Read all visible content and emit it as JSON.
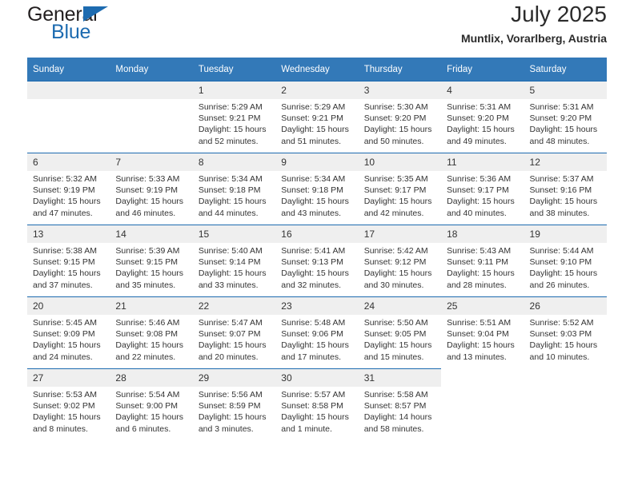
{
  "brand": {
    "name_top": "General",
    "name_bottom": "Blue",
    "accent_color": "#1d6bb0",
    "triangle_icon": "triangle-right-icon"
  },
  "header": {
    "title": "July 2025",
    "subtitle": "Muntlix, Vorarlberg, Austria"
  },
  "calendar": {
    "header_bg": "#3379b8",
    "divider_color": "#1d6bb0",
    "daynum_bg": "#efefef",
    "weekdays": [
      "Sunday",
      "Monday",
      "Tuesday",
      "Wednesday",
      "Thursday",
      "Friday",
      "Saturday"
    ],
    "weeks": [
      [
        {
          "day": "",
          "blank": true,
          "lines": []
        },
        {
          "day": "",
          "blank": true,
          "lines": []
        },
        {
          "day": "1",
          "lines": [
            "Sunrise: 5:29 AM",
            "Sunset: 9:21 PM",
            "Daylight: 15 hours",
            "and 52 minutes."
          ]
        },
        {
          "day": "2",
          "lines": [
            "Sunrise: 5:29 AM",
            "Sunset: 9:21 PM",
            "Daylight: 15 hours",
            "and 51 minutes."
          ]
        },
        {
          "day": "3",
          "lines": [
            "Sunrise: 5:30 AM",
            "Sunset: 9:20 PM",
            "Daylight: 15 hours",
            "and 50 minutes."
          ]
        },
        {
          "day": "4",
          "lines": [
            "Sunrise: 5:31 AM",
            "Sunset: 9:20 PM",
            "Daylight: 15 hours",
            "and 49 minutes."
          ]
        },
        {
          "day": "5",
          "lines": [
            "Sunrise: 5:31 AM",
            "Sunset: 9:20 PM",
            "Daylight: 15 hours",
            "and 48 minutes."
          ]
        }
      ],
      [
        {
          "day": "6",
          "lines": [
            "Sunrise: 5:32 AM",
            "Sunset: 9:19 PM",
            "Daylight: 15 hours",
            "and 47 minutes."
          ]
        },
        {
          "day": "7",
          "lines": [
            "Sunrise: 5:33 AM",
            "Sunset: 9:19 PM",
            "Daylight: 15 hours",
            "and 46 minutes."
          ]
        },
        {
          "day": "8",
          "lines": [
            "Sunrise: 5:34 AM",
            "Sunset: 9:18 PM",
            "Daylight: 15 hours",
            "and 44 minutes."
          ]
        },
        {
          "day": "9",
          "lines": [
            "Sunrise: 5:34 AM",
            "Sunset: 9:18 PM",
            "Daylight: 15 hours",
            "and 43 minutes."
          ]
        },
        {
          "day": "10",
          "lines": [
            "Sunrise: 5:35 AM",
            "Sunset: 9:17 PM",
            "Daylight: 15 hours",
            "and 42 minutes."
          ]
        },
        {
          "day": "11",
          "lines": [
            "Sunrise: 5:36 AM",
            "Sunset: 9:17 PM",
            "Daylight: 15 hours",
            "and 40 minutes."
          ]
        },
        {
          "day": "12",
          "lines": [
            "Sunrise: 5:37 AM",
            "Sunset: 9:16 PM",
            "Daylight: 15 hours",
            "and 38 minutes."
          ]
        }
      ],
      [
        {
          "day": "13",
          "lines": [
            "Sunrise: 5:38 AM",
            "Sunset: 9:15 PM",
            "Daylight: 15 hours",
            "and 37 minutes."
          ]
        },
        {
          "day": "14",
          "lines": [
            "Sunrise: 5:39 AM",
            "Sunset: 9:15 PM",
            "Daylight: 15 hours",
            "and 35 minutes."
          ]
        },
        {
          "day": "15",
          "lines": [
            "Sunrise: 5:40 AM",
            "Sunset: 9:14 PM",
            "Daylight: 15 hours",
            "and 33 minutes."
          ]
        },
        {
          "day": "16",
          "lines": [
            "Sunrise: 5:41 AM",
            "Sunset: 9:13 PM",
            "Daylight: 15 hours",
            "and 32 minutes."
          ]
        },
        {
          "day": "17",
          "lines": [
            "Sunrise: 5:42 AM",
            "Sunset: 9:12 PM",
            "Daylight: 15 hours",
            "and 30 minutes."
          ]
        },
        {
          "day": "18",
          "lines": [
            "Sunrise: 5:43 AM",
            "Sunset: 9:11 PM",
            "Daylight: 15 hours",
            "and 28 minutes."
          ]
        },
        {
          "day": "19",
          "lines": [
            "Sunrise: 5:44 AM",
            "Sunset: 9:10 PM",
            "Daylight: 15 hours",
            "and 26 minutes."
          ]
        }
      ],
      [
        {
          "day": "20",
          "lines": [
            "Sunrise: 5:45 AM",
            "Sunset: 9:09 PM",
            "Daylight: 15 hours",
            "and 24 minutes."
          ]
        },
        {
          "day": "21",
          "lines": [
            "Sunrise: 5:46 AM",
            "Sunset: 9:08 PM",
            "Daylight: 15 hours",
            "and 22 minutes."
          ]
        },
        {
          "day": "22",
          "lines": [
            "Sunrise: 5:47 AM",
            "Sunset: 9:07 PM",
            "Daylight: 15 hours",
            "and 20 minutes."
          ]
        },
        {
          "day": "23",
          "lines": [
            "Sunrise: 5:48 AM",
            "Sunset: 9:06 PM",
            "Daylight: 15 hours",
            "and 17 minutes."
          ]
        },
        {
          "day": "24",
          "lines": [
            "Sunrise: 5:50 AM",
            "Sunset: 9:05 PM",
            "Daylight: 15 hours",
            "and 15 minutes."
          ]
        },
        {
          "day": "25",
          "lines": [
            "Sunrise: 5:51 AM",
            "Sunset: 9:04 PM",
            "Daylight: 15 hours",
            "and 13 minutes."
          ]
        },
        {
          "day": "26",
          "lines": [
            "Sunrise: 5:52 AM",
            "Sunset: 9:03 PM",
            "Daylight: 15 hours",
            "and 10 minutes."
          ]
        }
      ],
      [
        {
          "day": "27",
          "lines": [
            "Sunrise: 5:53 AM",
            "Sunset: 9:02 PM",
            "Daylight: 15 hours",
            "and 8 minutes."
          ]
        },
        {
          "day": "28",
          "lines": [
            "Sunrise: 5:54 AM",
            "Sunset: 9:00 PM",
            "Daylight: 15 hours",
            "and 6 minutes."
          ]
        },
        {
          "day": "29",
          "lines": [
            "Sunrise: 5:56 AM",
            "Sunset: 8:59 PM",
            "Daylight: 15 hours",
            "and 3 minutes."
          ]
        },
        {
          "day": "30",
          "lines": [
            "Sunrise: 5:57 AM",
            "Sunset: 8:58 PM",
            "Daylight: 15 hours",
            "and 1 minute."
          ]
        },
        {
          "day": "31",
          "lines": [
            "Sunrise: 5:58 AM",
            "Sunset: 8:57 PM",
            "Daylight: 14 hours",
            "and 58 minutes."
          ]
        },
        {
          "day": "",
          "blank": true,
          "lines": []
        },
        {
          "day": "",
          "blank": true,
          "lines": []
        }
      ]
    ]
  }
}
